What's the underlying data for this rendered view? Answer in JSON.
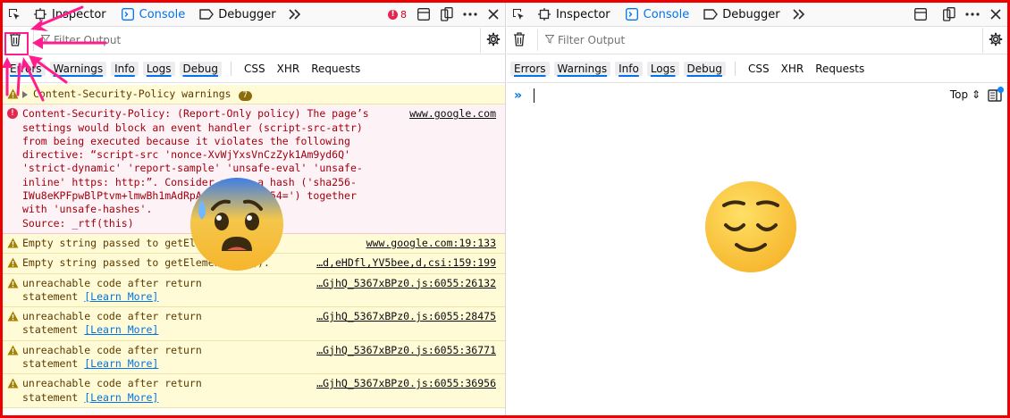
{
  "left": {
    "tabs": [
      {
        "label": "Inspector",
        "icon": "inspector-icon"
      },
      {
        "label": "Console",
        "icon": "console-icon",
        "selected": true
      },
      {
        "label": "Debugger",
        "icon": "debugger-icon"
      }
    ],
    "error_count": "8",
    "filter_placeholder": "Filter Output",
    "chips": [
      "Errors",
      "Warnings",
      "Info",
      "Logs",
      "Debug"
    ],
    "chips_plain": [
      "CSS",
      "XHR",
      "Requests"
    ],
    "messages": {
      "group": {
        "text": "Content-Security-Policy warnings",
        "count": "7"
      },
      "csp_error": {
        "text": "Content-Security-Policy: (Report-Only policy) The page’s\nsettings would block an event handler (script-src-attr)\nfrom being executed because it violates the following\ndirective: “script-src 'nonce-XvWjYxsVnCzZyk1Am9yd6Q'\n'strict-dynamic' 'report-sample' 'unsafe-eval' 'unsafe-\ninline' https: http:”. Consider using a hash ('sha256-\nIWu8eKPFpwBlPtvm+lmwBh1mAdRpA4fkn1ToR3FA54=') together\nwith 'unsafe-hashes'.\nSource: _rtf(this)",
        "location": "www.google.com"
      },
      "empty1": {
        "text": "Empty string passed to getElementById().",
        "location": "www.google.com:19:133"
      },
      "empty2": {
        "text": "Empty string passed to getElementById().",
        "location": "…d,eHDfl,YV5bee,d,csi:159:199"
      },
      "unreachable": [
        {
          "text": "unreachable code after return\nstatement ",
          "learn": "[Learn More]",
          "location": "…GjhQ_5367xBPz0.js:6055:26132"
        },
        {
          "text": "unreachable code after return\nstatement ",
          "learn": "[Learn More]",
          "location": "…GjhQ_5367xBPz0.js:6055:28475"
        },
        {
          "text": "unreachable code after return\nstatement ",
          "learn": "[Learn More]",
          "location": "…GjhQ_5367xBPz0.js:6055:36771"
        },
        {
          "text": "unreachable code after return\nstatement ",
          "learn": "[Learn More]",
          "location": "…GjhQ_5367xBPz0.js:6055:36956"
        }
      ]
    }
  },
  "right": {
    "tabs": [
      {
        "label": "Inspector",
        "icon": "inspector-icon"
      },
      {
        "label": "Console",
        "icon": "console-icon",
        "selected": true
      },
      {
        "label": "Debugger",
        "icon": "debugger-icon"
      }
    ],
    "filter_placeholder": "Filter Output",
    "chips": [
      "Errors",
      "Warnings",
      "Info",
      "Logs",
      "Debug"
    ],
    "chips_plain": [
      "CSS",
      "XHR",
      "Requests"
    ],
    "prompt": "»",
    "context_selector": "Top ⇕"
  },
  "colors": {
    "accent": "#0074e8",
    "frame": "#ee0000",
    "annotation": "#ff1c8d",
    "warning_bg": "#fffbd6",
    "error_bg": "#fdf2f5"
  },
  "emojis": {
    "left": "anxious-face-with-sweat",
    "right": "relieved-face"
  }
}
